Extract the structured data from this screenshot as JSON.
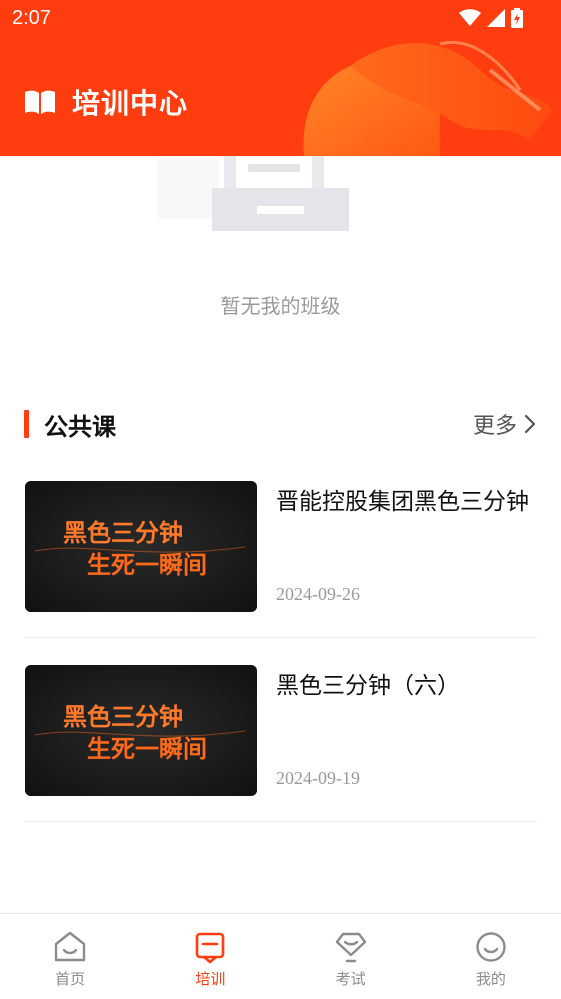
{
  "status_bar": {
    "time": "2:07"
  },
  "header": {
    "title": "培训中心"
  },
  "empty_state": {
    "message": "暂无我的班级"
  },
  "section": {
    "title": "公共课",
    "more_label": "更多"
  },
  "courses": [
    {
      "title": "晋能控股集团黑色三分钟",
      "date": "2024-09-26",
      "thumb_lines": [
        "黑色三分钟",
        "生死一瞬间"
      ]
    },
    {
      "title": "黑色三分钟（六）",
      "date": "2024-09-19",
      "thumb_lines": [
        "黑色三分钟",
        "生死一瞬间"
      ]
    }
  ],
  "bottom_nav": {
    "items": [
      {
        "label": "首页",
        "icon": "home-icon",
        "active": false
      },
      {
        "label": "培训",
        "icon": "training-icon",
        "active": true
      },
      {
        "label": "考试",
        "icon": "exam-icon",
        "active": false
      },
      {
        "label": "我的",
        "icon": "profile-icon",
        "active": false
      }
    ]
  },
  "colors": {
    "brand": "#ff3d0e",
    "muted_text": "#9a9a9a",
    "nav_inactive": "#8c8c8c"
  }
}
